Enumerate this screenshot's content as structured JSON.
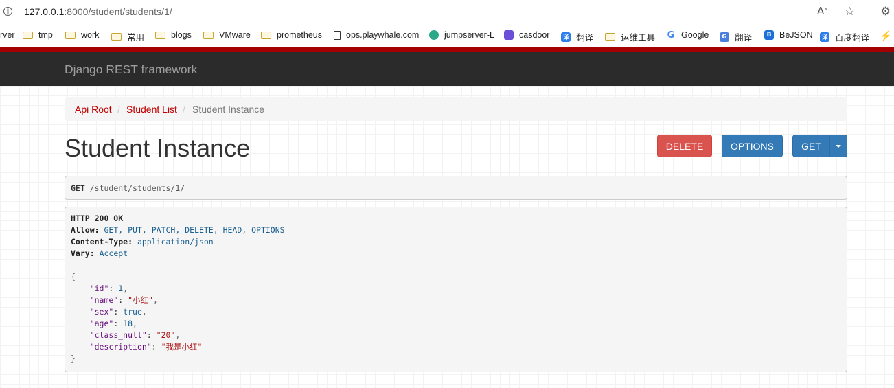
{
  "browser": {
    "url_host": "127.0.0.1",
    "url_path": ":8000/student/students/1/",
    "bookmarks": [
      {
        "label": "rver",
        "icon": "none"
      },
      {
        "label": "tmp",
        "icon": "folder-icon"
      },
      {
        "label": "work",
        "icon": "folder-icon"
      },
      {
        "label": "常用",
        "icon": "folder-icon"
      },
      {
        "label": "blogs",
        "icon": "folder-icon"
      },
      {
        "label": "VMware",
        "icon": "folder-icon"
      },
      {
        "label": "prometheus",
        "icon": "folder-icon"
      },
      {
        "label": "ops.playwhale.com",
        "icon": "page-icon"
      },
      {
        "label": "jumpserver-L",
        "icon": "jumpserver-icon"
      },
      {
        "label": "casdoor",
        "icon": "casdoor-icon"
      },
      {
        "label": "翻译",
        "icon": "translate-icon"
      },
      {
        "label": "运维工具",
        "icon": "folder-icon"
      },
      {
        "label": "Google",
        "icon": "google-icon"
      },
      {
        "label": "翻译",
        "icon": "google-translate-icon"
      },
      {
        "label": "BeJSON",
        "icon": "bejson-icon"
      },
      {
        "label": "百度翻译",
        "icon": "translate-icon"
      }
    ]
  },
  "navbar": {
    "brand": "Django REST framework"
  },
  "breadcrumb": {
    "items": [
      "Api Root",
      "Student List",
      "Student Instance"
    ],
    "separator": "/"
  },
  "page": {
    "title": "Student Instance"
  },
  "buttons": {
    "delete": "DELETE",
    "options": "OPTIONS",
    "get": "GET"
  },
  "request": {
    "method": "GET",
    "path": "/student/students/1/"
  },
  "response": {
    "status": "HTTP 200 OK",
    "headers": [
      {
        "name": "Allow:",
        "value": "GET, PUT, PATCH, DELETE, HEAD, OPTIONS"
      },
      {
        "name": "Content-Type:",
        "value": "application/json"
      },
      {
        "name": "Vary:",
        "value": "Accept"
      }
    ],
    "body": [
      {
        "key": "\"id\"",
        "value": "1",
        "type": "num"
      },
      {
        "key": "\"name\"",
        "value": "\"小红\"",
        "type": "str"
      },
      {
        "key": "\"sex\"",
        "value": "true",
        "type": "num"
      },
      {
        "key": "\"age\"",
        "value": "18",
        "type": "num"
      },
      {
        "key": "\"class_null\"",
        "value": "\"20\"",
        "type": "str"
      },
      {
        "key": "\"description\"",
        "value": "\"我是小红\"",
        "type": "str"
      }
    ]
  },
  "colors": {
    "navbar_bg": "#2b2b2b",
    "accent_red": "#a40000",
    "link": "#c20000",
    "primary": "#337ab7",
    "danger": "#d9534f"
  }
}
